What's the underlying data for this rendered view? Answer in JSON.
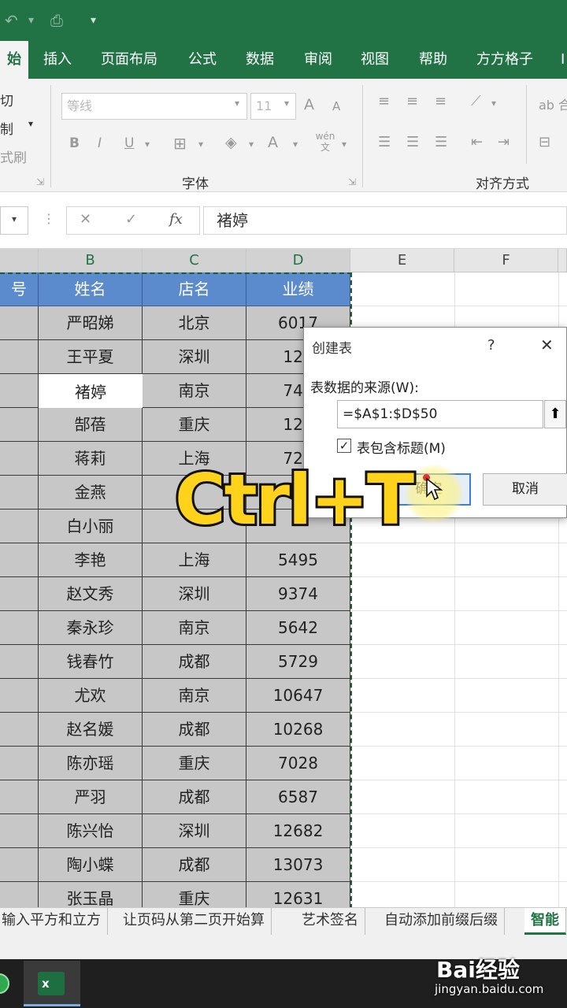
{
  "ribbon_tabs": [
    "始",
    "插入",
    "页面布局",
    "公式",
    "数据",
    "审阅",
    "视图",
    "帮助",
    "方方格子",
    "I"
  ],
  "clipboard": {
    "cut": "切",
    "copy": "制",
    "painter": "式刷"
  },
  "font": {
    "name": "等线",
    "size": "11",
    "bold": "B",
    "italic": "I",
    "underline": "U",
    "color_a": "A",
    "group_label": "字体",
    "grow": "A",
    "shrink": "A",
    "wen": "wén文"
  },
  "align": {
    "group_label": "对齐方式",
    "extra": "ab 合"
  },
  "formula_bar": {
    "cancel": "✕",
    "enter": "✓",
    "fx": "fx",
    "content": "褚婷"
  },
  "columns": [
    "B",
    "C",
    "D",
    "E",
    "F"
  ],
  "table": {
    "head_a": "号",
    "headers": [
      "姓名",
      "店名",
      "业绩"
    ],
    "rows": [
      [
        "严昭娣",
        "北京",
        "6017"
      ],
      [
        "王平夏",
        "深圳",
        "124"
      ],
      [
        "褚婷",
        "南京",
        "743"
      ],
      [
        "郜蓓",
        "重庆",
        "129"
      ],
      [
        "蒋莉",
        "上海",
        "724"
      ],
      [
        "金燕",
        "",
        "",
        ""
      ],
      [
        "白小丽",
        "",
        "",
        ""
      ],
      [
        "李艳",
        "上海",
        "5495"
      ],
      [
        "赵文秀",
        "深圳",
        "9374"
      ],
      [
        "秦永珍",
        "南京",
        "5642"
      ],
      [
        "钱春竹",
        "成都",
        "5729"
      ],
      [
        "尤欢",
        "南京",
        "10647"
      ],
      [
        "赵名媛",
        "成都",
        "10268"
      ],
      [
        "陈亦瑶",
        "重庆",
        "7028"
      ],
      [
        "严羽",
        "成都",
        "6587"
      ],
      [
        "陈兴怡",
        "深圳",
        "12682"
      ],
      [
        "陶小蝶",
        "成都",
        "13073"
      ],
      [
        "张玉晶",
        "重庆",
        "12631"
      ]
    ]
  },
  "dialog": {
    "title": "创建表",
    "help": "?",
    "close": "✕",
    "source_label": "表数据的来源(W):",
    "source_value": "=$A$1:$D$50",
    "has_headers": "表包含标题(M)",
    "ok": "确定",
    "cancel": "取消"
  },
  "overlay_text": "Ctrl+T",
  "sheet_tabs": [
    "输入平方和立方",
    "让页码从第二页开始算",
    "艺术签名",
    "自动添加前缀后缀",
    "智能"
  ],
  "watermark": {
    "brand": "Bai经验",
    "url": "jingyan.baidu.com"
  },
  "colors": {
    "excel_green": "#217346",
    "table_header": "#5b8bcd",
    "overlay_yellow": "#ffd21c"
  }
}
